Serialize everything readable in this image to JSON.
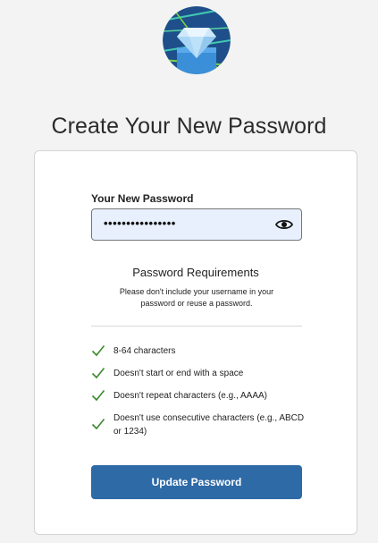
{
  "header": {
    "logo_icon": "diamond-logo-icon",
    "title": "Create Your New Password"
  },
  "form": {
    "password_label": "Your New Password",
    "password_value": "••••••••••••••••",
    "eye_icon": "eye-icon"
  },
  "requirements": {
    "title": "Password Requirements",
    "description": "Please don't include your username in your password or reuse a password.",
    "items": [
      "8-64 characters",
      "Doesn't start or end with a space",
      "Doesn't repeat characters (e.g., AAAA)",
      "Doesn't use consecutive characters (e.g., ABCD or 1234)"
    ],
    "check_icon": "check-icon"
  },
  "actions": {
    "update_label": "Update Password"
  },
  "colors": {
    "background": "#f3f3f3",
    "button": "#2e6aa6",
    "check": "#3c8a2e",
    "field_bg": "#e8f0fe"
  }
}
